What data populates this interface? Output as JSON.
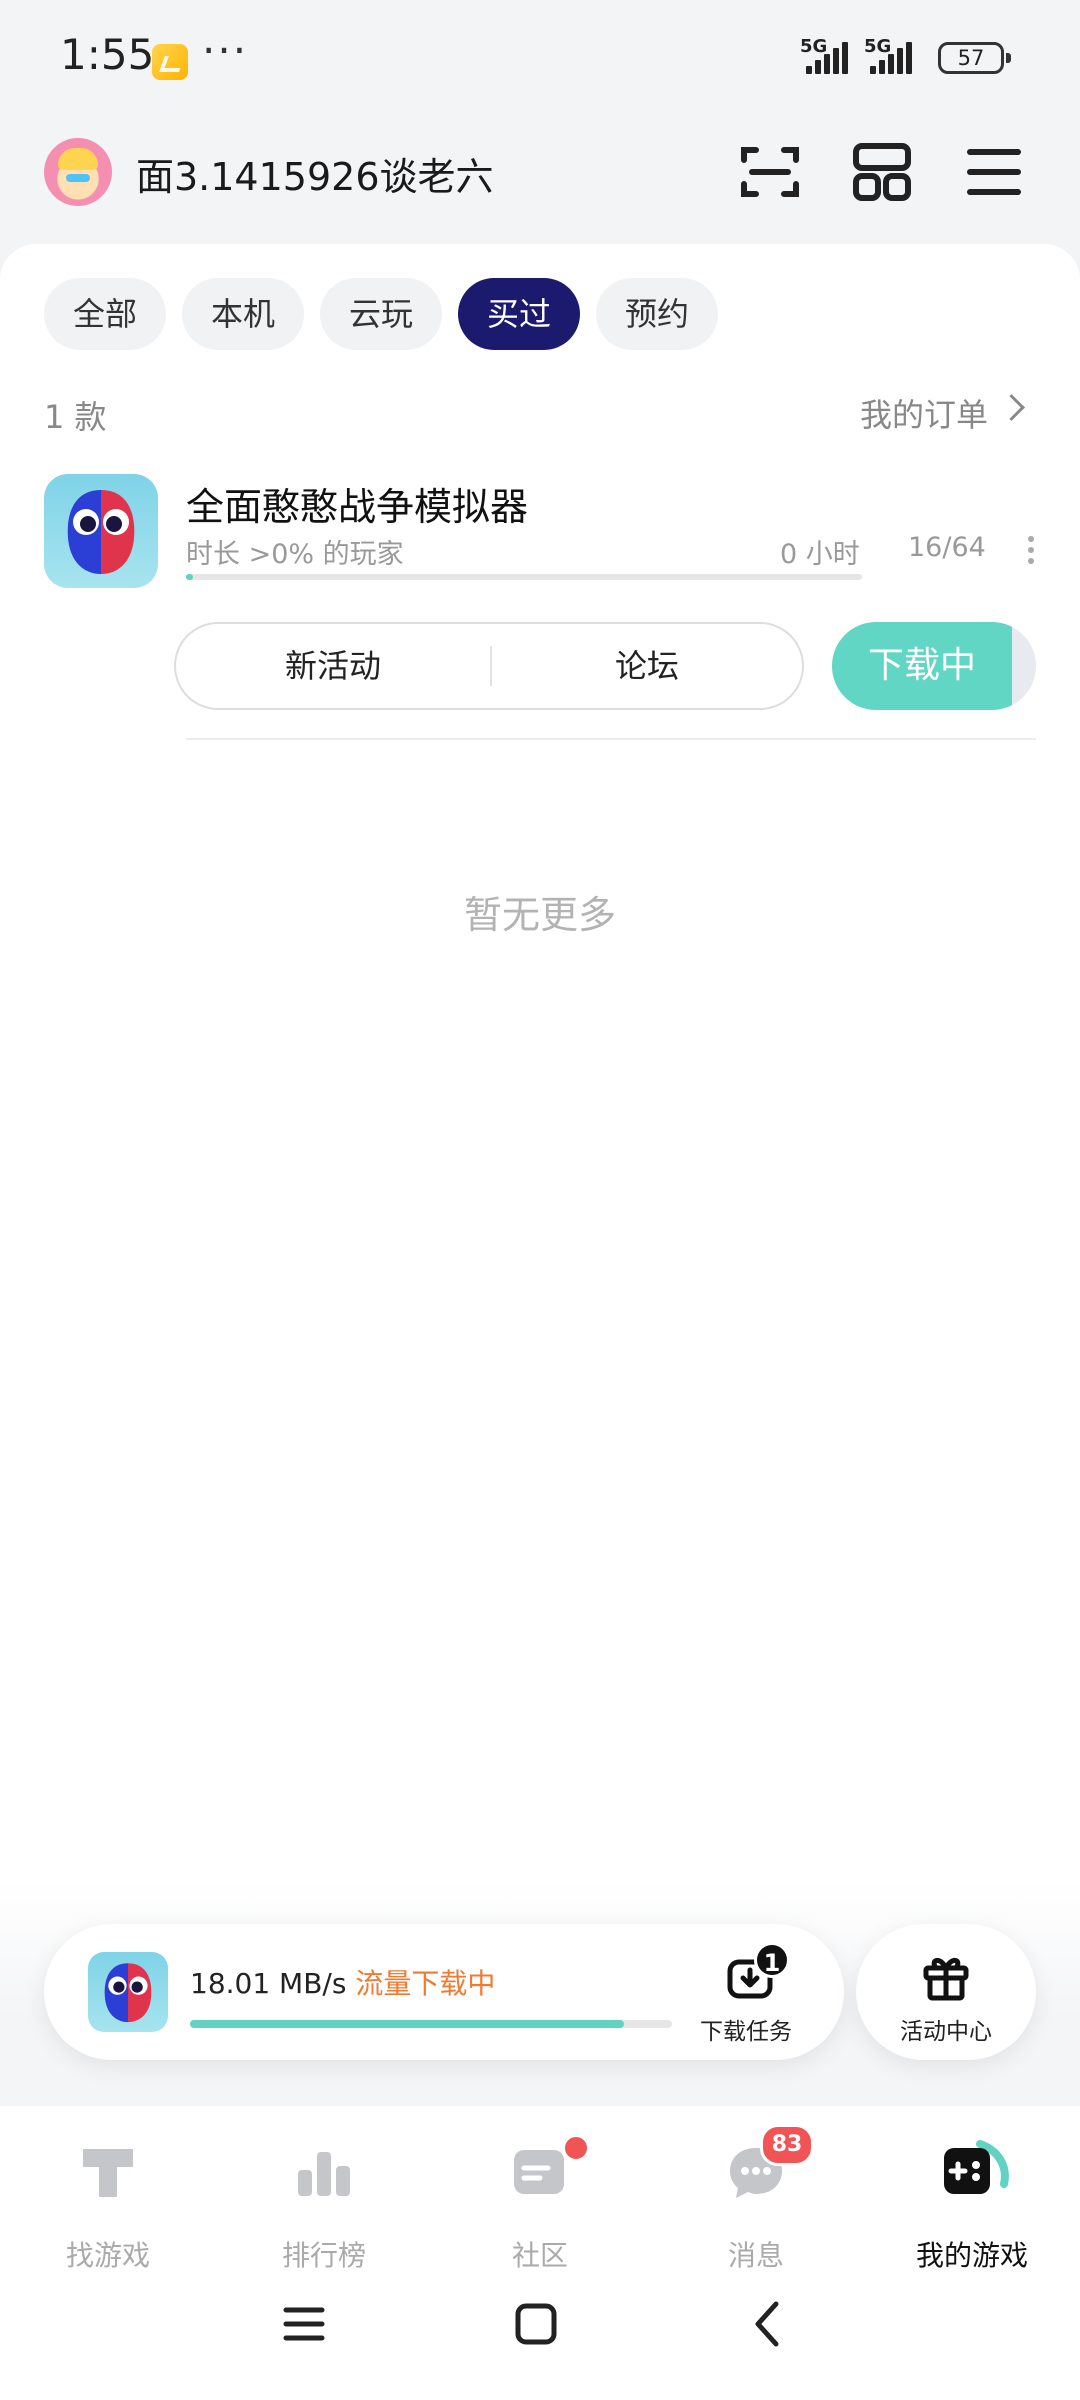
{
  "status_bar": {
    "time": "1:55",
    "more": "···",
    "signal1": "5G",
    "signal2": "5G",
    "battery": "57"
  },
  "header": {
    "username": "面3.1415926谈老六",
    "icons": [
      "scan-icon",
      "apps-grid-icon",
      "menu-icon"
    ]
  },
  "tabs": [
    {
      "label": "全部",
      "active": false
    },
    {
      "label": "本机",
      "active": false
    },
    {
      "label": "云玩",
      "active": false
    },
    {
      "label": "买过",
      "active": true
    },
    {
      "label": "预约",
      "active": false
    }
  ],
  "list": {
    "count": "1 款",
    "my_orders": "我的订单"
  },
  "game": {
    "title": "全面憨憨战争模拟器",
    "subtitle": "时长 >0% 的玩家",
    "hours": "0 小时",
    "slots": "16/64",
    "progress": 0.01,
    "actions": {
      "new_activity": "新活动",
      "forum": "论坛",
      "download": "下载中"
    },
    "download_progress": 0.88
  },
  "empty_tip": "暂无更多",
  "download_panel": {
    "speed": "18.01 MB/s",
    "status": "流量下载中",
    "progress": 0.9,
    "task_badge": "1",
    "task_label": "下载任务",
    "activity_label": "活动中心"
  },
  "bottom_nav": [
    {
      "label": "找游戏",
      "icon": "find-games-icon",
      "active": false
    },
    {
      "label": "排行榜",
      "icon": "leaderboard-icon",
      "active": false
    },
    {
      "label": "社区",
      "icon": "community-icon",
      "active": false,
      "dot": true
    },
    {
      "label": "消息",
      "icon": "messages-icon",
      "active": false,
      "badge": "83"
    },
    {
      "label": "我的游戏",
      "icon": "my-games-icon",
      "active": true
    }
  ],
  "colors": {
    "accent_dark": "#1c1a6e",
    "accent_teal": "#62d3c2",
    "warning_orange": "#f07a32",
    "badge_red": "#f05454"
  }
}
